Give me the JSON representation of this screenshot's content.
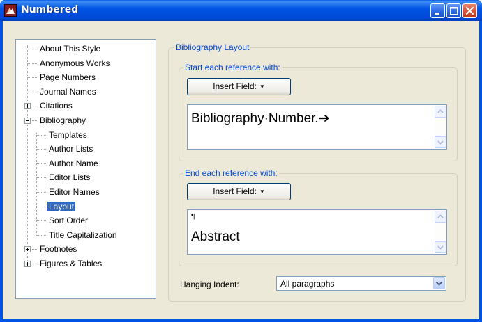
{
  "window": {
    "title": "Numbered"
  },
  "tree": {
    "items": [
      {
        "label": "About This Style",
        "level": 0,
        "expander": null,
        "selected": false
      },
      {
        "label": "Anonymous Works",
        "level": 0,
        "expander": null,
        "selected": false
      },
      {
        "label": "Page Numbers",
        "level": 0,
        "expander": null,
        "selected": false
      },
      {
        "label": "Journal Names",
        "level": 0,
        "expander": null,
        "selected": false
      },
      {
        "label": "Citations",
        "level": 0,
        "expander": "plus",
        "selected": false
      },
      {
        "label": "Bibliography",
        "level": 0,
        "expander": "minus",
        "selected": false
      },
      {
        "label": "Templates",
        "level": 1,
        "expander": null,
        "selected": false
      },
      {
        "label": "Author Lists",
        "level": 1,
        "expander": null,
        "selected": false
      },
      {
        "label": "Author Name",
        "level": 1,
        "expander": null,
        "selected": false
      },
      {
        "label": "Editor Lists",
        "level": 1,
        "expander": null,
        "selected": false
      },
      {
        "label": "Editor Names",
        "level": 1,
        "expander": null,
        "selected": false
      },
      {
        "label": "Layout",
        "level": 1,
        "expander": null,
        "selected": true
      },
      {
        "label": "Sort Order",
        "level": 1,
        "expander": null,
        "selected": false
      },
      {
        "label": "Title Capitalization",
        "level": 1,
        "expander": null,
        "selected": false
      },
      {
        "label": "Footnotes",
        "level": 0,
        "expander": "plus",
        "selected": false
      },
      {
        "label": "Figures & Tables",
        "level": 0,
        "expander": "plus",
        "selected": false
      }
    ]
  },
  "layout_panel": {
    "group_title": "Bibliography Layout",
    "start": {
      "title": "Start each reference with:",
      "button_label_underlined": "I",
      "button_label_rest": "nsert Field:",
      "field_text": "Bibliography·Number.➔"
    },
    "end": {
      "title": "End each reference with:",
      "button_label_underlined": "I",
      "button_label_rest": "nsert Field:",
      "pilcrow": "¶",
      "field_text": "Abstract"
    },
    "hanging_indent": {
      "label": "Hanging Indent:",
      "value": "All paragraphs"
    }
  },
  "colors": {
    "titlebar": "#0054e3",
    "selection": "#316ac5",
    "groupbox_title": "#0046d5"
  }
}
